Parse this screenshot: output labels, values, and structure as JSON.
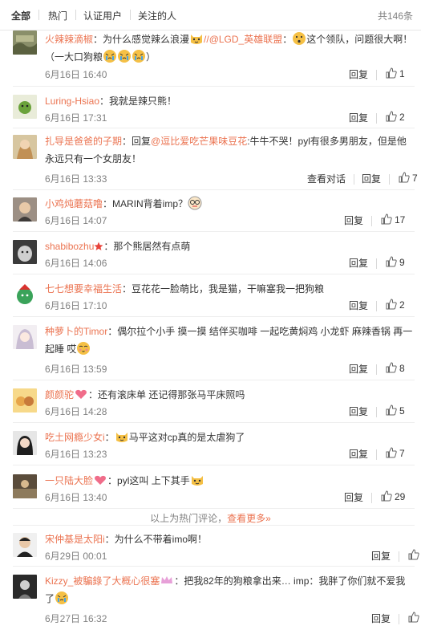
{
  "tabs": [
    {
      "label": "全部",
      "active": true
    },
    {
      "label": "热门",
      "active": false
    },
    {
      "label": "认证用户",
      "active": false
    },
    {
      "label": "关注的人",
      "active": false
    }
  ],
  "total_count": "共146条",
  "actions": {
    "reply": "回复",
    "view_conversation": "查看对话"
  },
  "comments": [
    {
      "user": "火辣辣滴椒",
      "text_a": "：为什么感觉辣么浪漫",
      "mention": "//@LGD_英雄联盟",
      "text_b": "：",
      "text_c": "这个领队，问题很大啊！（一大口狗粮",
      "text_d": "）",
      "time": "6月16日 16:40",
      "likes": "1"
    },
    {
      "user": "Luring-Hsiao",
      "text_a": "：我就是辣只熊！",
      "time": "6月16日 17:31",
      "likes": "2"
    },
    {
      "user": "扎导是爸爸的子期",
      "text_a": "：回复",
      "mention": "@逗比爱吃芒果味豆花",
      "text_b": ":牛牛不哭！pyl有很多男朋友，但是他永远只有一个女朋友！",
      "time": "6月16日 13:33",
      "likes": "7"
    },
    {
      "user": "小鸡炖蘑菇噜",
      "text_a": "：MARIN背着imp？",
      "time": "6月16日 14:07",
      "likes": "17"
    },
    {
      "user": "shabibozhu",
      "text_a": "：那个熊居然有点萌",
      "time": "6月16日 14:06",
      "likes": "9"
    },
    {
      "user": "七七想要幸福生活",
      "text_a": "：豆花花一脸萌比，我是猫，干嘛塞我一把狗粮",
      "time": "6月16日 17:10",
      "likes": "2"
    },
    {
      "user": "种萝卜的Timor",
      "text_a": "：偶尔拉个小手 摸一摸 结伴买咖啡 一起吃黄焖鸡 小龙虾 麻辣香锅 再一起睡 哎",
      "time": "6月16日 13:59",
      "likes": "8"
    },
    {
      "user": "颜颜驼",
      "text_a": "：还有滚床单 还记得那张马平床照吗",
      "time": "6月16日 14:28",
      "likes": "5"
    },
    {
      "user": "吃土网瘾少女i",
      "text_a": "：",
      "text_b": "马平这对cp真的是太虐狗了",
      "time": "6月16日 13:23",
      "likes": "7"
    },
    {
      "user": "一只陆大脸",
      "text_a": "：pyl这叫 上下其手",
      "time": "6月16日 13:40",
      "likes": "29"
    },
    {
      "user": "宋仲基是太阳i",
      "text_a": "：为什么不带着imo啊！",
      "time": "6月29日 00:01"
    },
    {
      "user": "Kizzy_被騙錄了大概心很塞",
      "text_a": "：把我82年的狗粮拿出来… imp：我胖了你们就不爱我了",
      "time": "6月27日 16:32"
    }
  ],
  "hot_divider": {
    "text": "以上为热门评论，",
    "more": "查看更多»"
  },
  "colors": {
    "accent": "#eb7350",
    "meta": "#808080",
    "text": "#333333",
    "like_icon": "#666666"
  }
}
